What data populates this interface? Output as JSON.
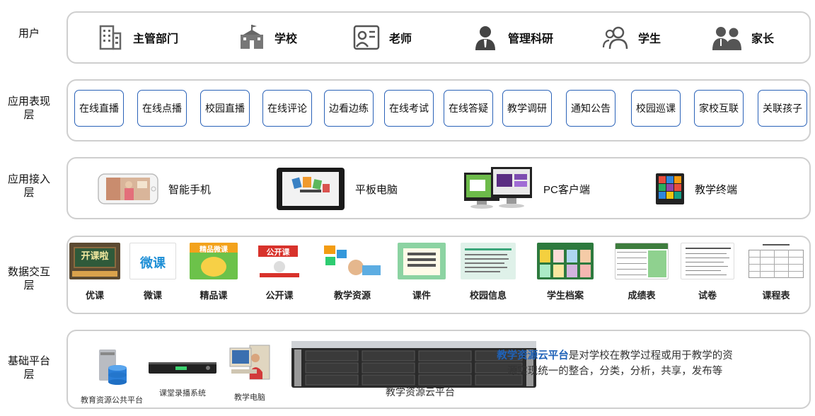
{
  "layers": {
    "users": "用户",
    "apps": "应用表现层",
    "access": "应用接入层",
    "data": "数据交互层",
    "base": "基础平台层"
  },
  "users": [
    {
      "label": "主管部门",
      "icon": "building-icon"
    },
    {
      "label": "学校",
      "icon": "school-icon"
    },
    {
      "label": "老师",
      "icon": "teacher-icon"
    },
    {
      "label": "管理科研",
      "icon": "manager-icon"
    },
    {
      "label": "学生",
      "icon": "students-icon"
    },
    {
      "label": "家长",
      "icon": "parents-icon"
    }
  ],
  "apps": [
    {
      "label": "在线直播"
    },
    {
      "label": "在线点播"
    },
    {
      "label": "校园直播"
    },
    {
      "label": "在线评论"
    },
    {
      "label": "边看边练"
    },
    {
      "label": "在线考试"
    },
    {
      "label": "在线答疑"
    },
    {
      "label": "教学调研"
    },
    {
      "label": "通知公告"
    },
    {
      "label": "校园巡课"
    },
    {
      "label": "家校互联"
    },
    {
      "label": "关联孩子"
    }
  ],
  "access": [
    {
      "label": "智能手机",
      "icon": "smartphone-icon"
    },
    {
      "label": "平板电脑",
      "icon": "tablet-icon"
    },
    {
      "label": "PC客户端",
      "icon": "pc-icon"
    },
    {
      "label": "教学终端",
      "icon": "terminal-icon"
    }
  ],
  "data": [
    {
      "label": "优课",
      "thumb_text": "开课啦"
    },
    {
      "label": "微课",
      "thumb_text": "微课"
    },
    {
      "label": "精品课",
      "thumb_text": "精品微课"
    },
    {
      "label": "公开课",
      "thumb_text": "公开课"
    },
    {
      "label": "教学资源"
    },
    {
      "label": "课件"
    },
    {
      "label": "校园信息"
    },
    {
      "label": "学生档案"
    },
    {
      "label": "成绩表"
    },
    {
      "label": "试卷"
    },
    {
      "label": "课程表"
    }
  ],
  "base": {
    "items": [
      {
        "label": "教育资源公共平台",
        "icon": "database-icon"
      },
      {
        "label": "课堂录播系统",
        "icon": "recorder-icon"
      },
      {
        "label": "教学电脑",
        "icon": "computer-icon"
      }
    ],
    "server_label": "教学资源云平台",
    "desc_highlight": "教学资源云平台",
    "desc_rest": "是对学校在教学过程或用于教学的资源实现统一的整合，分类，分析，共享，发布等"
  },
  "colors": {
    "border": "#cfcfcf",
    "button_border": "#2a62b8",
    "highlight": "#1f62b8"
  }
}
